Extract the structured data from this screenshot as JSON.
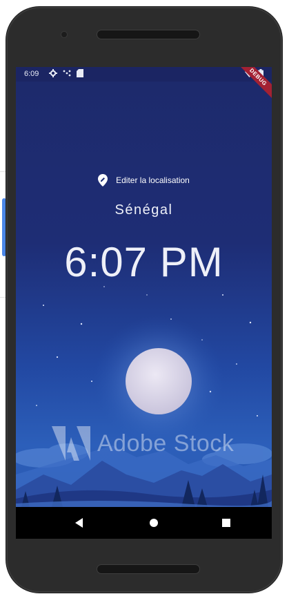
{
  "status_bar": {
    "time": "6:09",
    "left_icons": [
      "gear-icon",
      "signal-dots-icon",
      "sim-card-icon"
    ],
    "right_icons": [
      "wifi-icon",
      "battery-icon"
    ]
  },
  "debug_banner": {
    "label": "DEBUG",
    "color": "#a32133"
  },
  "location": {
    "edit_label": "Editer la localisation",
    "icon": "location-edit-icon"
  },
  "country": "Sénégal",
  "time": "6:07 PM",
  "watermark": {
    "text": "Adobe Stock",
    "logo": "adobe-logo"
  },
  "nav_bar": {
    "buttons": [
      "back-icon",
      "home-icon",
      "recents-icon"
    ]
  },
  "colors": {
    "sky_top": "#1d2a6b",
    "sky_bottom": "#2c5fba",
    "status_bar": "#1b2563",
    "text": "#eef0f8"
  }
}
